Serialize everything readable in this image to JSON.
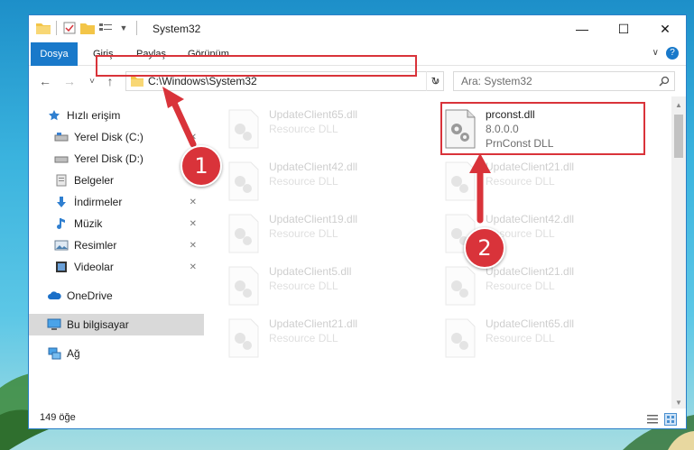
{
  "window": {
    "title": "System32",
    "minimize_label": "—",
    "maximize_label": "☐",
    "close_label": "✕"
  },
  "ribbon": {
    "tabs": [
      "Dosya",
      "Giriş",
      "Paylaş",
      "Görünüm"
    ],
    "help_label": "?"
  },
  "navigation": {
    "back_label": "←",
    "forward_label": "→",
    "recent_label": "˅",
    "up_label": "↑",
    "address": "C:\\Windows\\System32",
    "refresh_label": "↻",
    "search_placeholder": "Ara: System32"
  },
  "sidebar": {
    "items": [
      {
        "label": "Hızlı erişim",
        "icon": "star-icon"
      },
      {
        "label": "Yerel Disk (C:)",
        "icon": "drive-icon"
      },
      {
        "label": "Yerel Disk (D:)",
        "icon": "drive-icon"
      },
      {
        "label": "Belgeler",
        "icon": "documents-icon"
      },
      {
        "label": "İndirmeler",
        "icon": "download-icon"
      },
      {
        "label": "Müzik",
        "icon": "music-icon"
      },
      {
        "label": "Resimler",
        "icon": "pictures-icon"
      },
      {
        "label": "Videolar",
        "icon": "videos-icon"
      },
      {
        "label": "OneDrive",
        "icon": "cloud-icon"
      },
      {
        "label": "Bu bilgisayar",
        "icon": "computer-icon"
      },
      {
        "label": "Ağ",
        "icon": "network-icon"
      }
    ]
  },
  "files": {
    "highlighted": {
      "name": "prconst.dll",
      "version": "8.0.0.0",
      "description": "PrnConst DLL"
    },
    "faded_left": [
      {
        "name": "UpdateClient65.dll",
        "description": "Resource DLL"
      },
      {
        "name": "UpdateClient42.dll",
        "description": "Resource DLL"
      },
      {
        "name": "UpdateClient19.dll",
        "description": "Resource DLL"
      },
      {
        "name": "UpdateClient5.dll",
        "description": "Resource DLL"
      },
      {
        "name": "UpdateClient21.dll",
        "description": "Resource DLL"
      }
    ],
    "faded_right": [
      {
        "name": "UpdateClient21.dll",
        "description": "Resource DLL"
      },
      {
        "name": "UpdateClient42.dll",
        "description": "Resource DLL"
      },
      {
        "name": "UpdateClient21.dll",
        "description": "Resource DLL"
      },
      {
        "name": "UpdateClient65.dll",
        "description": "Resource DLL"
      }
    ]
  },
  "status": {
    "item_count": "149 öğe"
  },
  "annotations": {
    "step1": "1",
    "step2": "2",
    "color": "#d9333a"
  }
}
